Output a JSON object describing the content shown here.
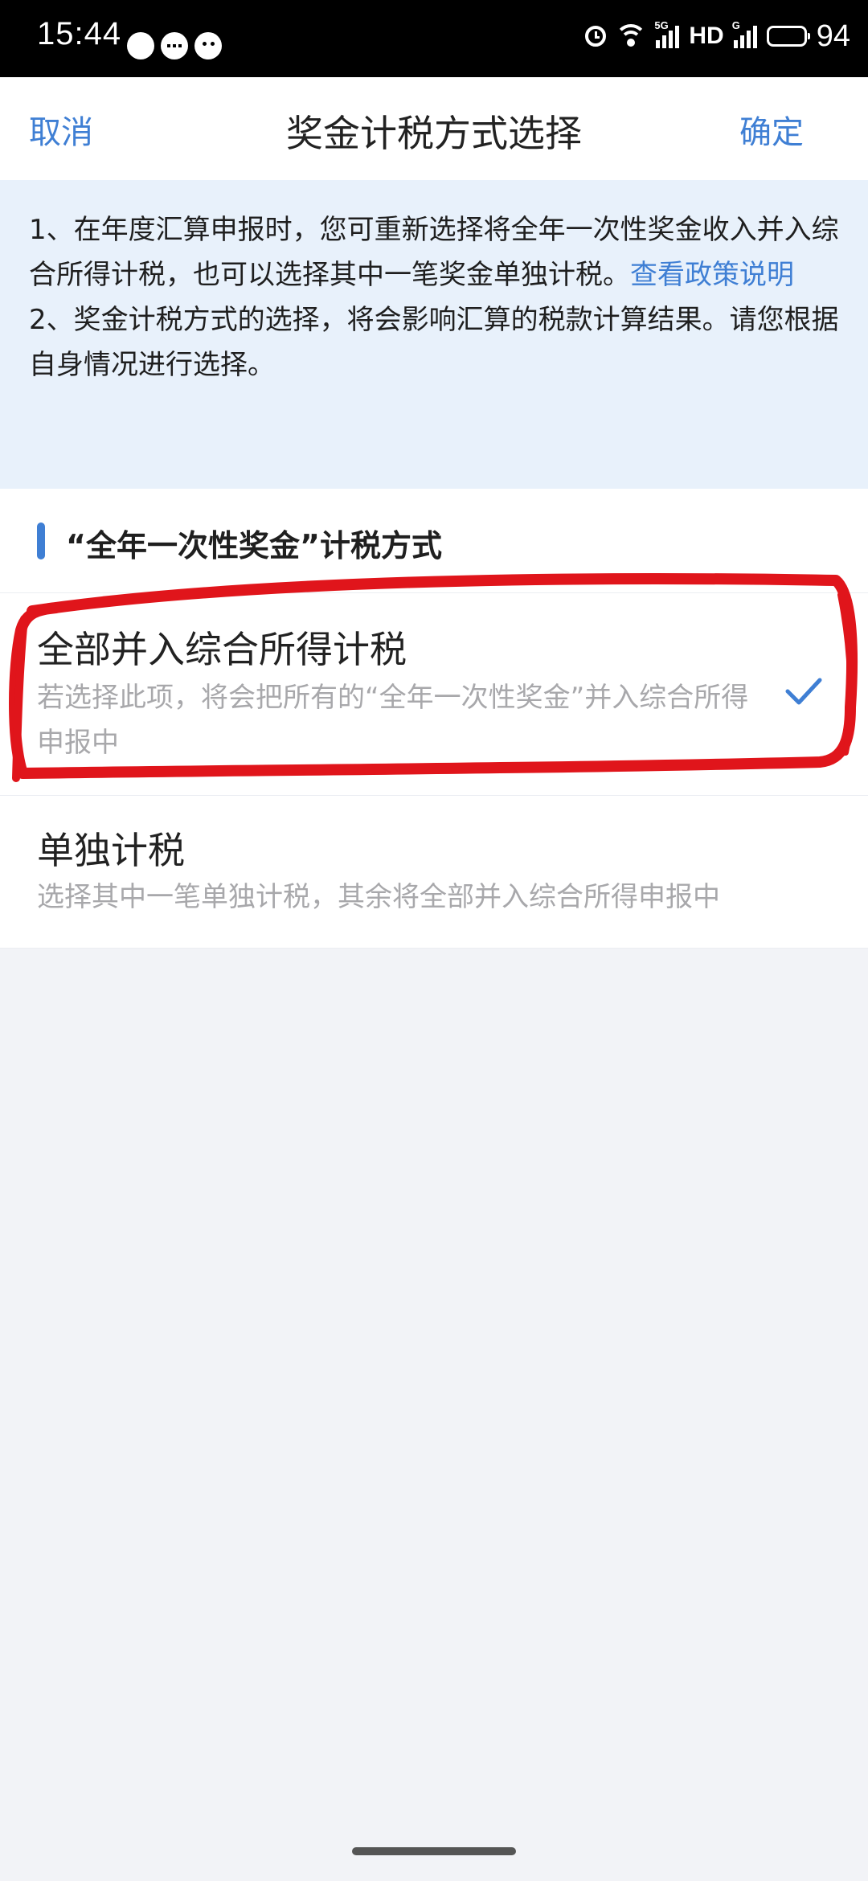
{
  "status_bar": {
    "time": "15:44",
    "network_tag_1": "5G",
    "network_tag_2": "G",
    "hd": "HD",
    "battery": "94",
    "battery_level": 0.94
  },
  "header": {
    "cancel_label": "取消",
    "title": "奖金计税方式选择",
    "confirm_label": "确定"
  },
  "notice": {
    "line1_text": "1、在年度汇算申报时，您可重新选择将全年一次性奖金收入并入综合所得计税，也可以选择其中一笔奖金单独计税。",
    "line1_link": "查看政策说明",
    "line2_text": "2、奖金计税方式的选择，将会影响汇算的税款计算结果。请您根据自身情况进行选择。"
  },
  "section": {
    "title": "“全年一次性奖金”计税方式"
  },
  "options": [
    {
      "title": "全部并入综合所得计税",
      "desc": "若选择此项，将会把所有的“全年一次性奖金”并入综合所得申报中",
      "selected": true
    },
    {
      "title": "单独计税",
      "desc": "选择其中一笔单独计税，其余将全部并入综合所得申报中",
      "selected": false
    }
  ],
  "colors": {
    "accent": "#3f7fd4",
    "notice_bg": "#e8f1fb",
    "annotation": "#e0151b"
  }
}
